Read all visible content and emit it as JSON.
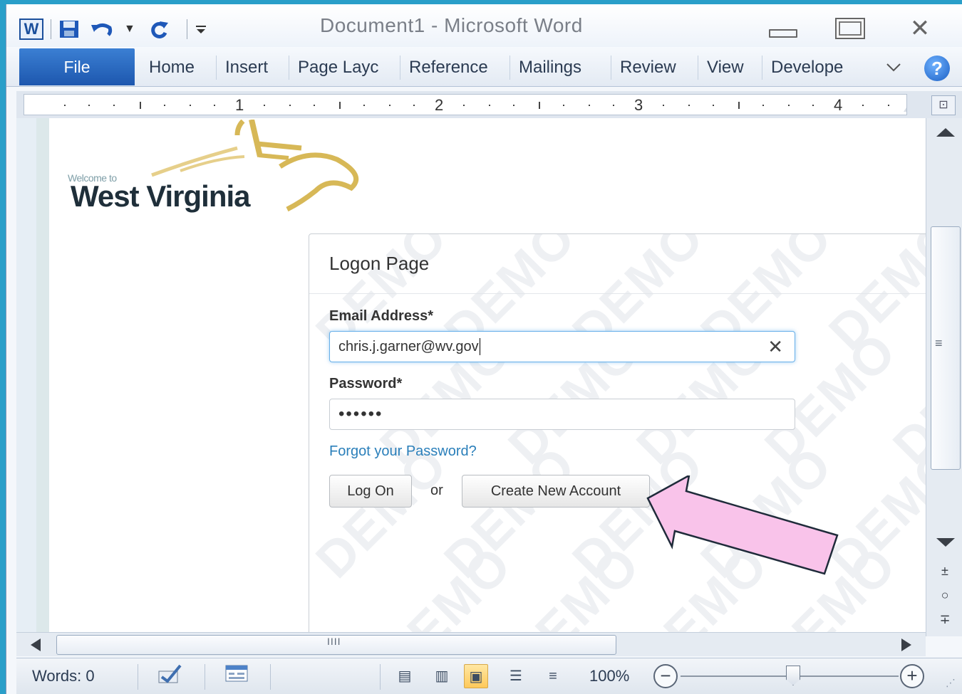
{
  "window": {
    "title": "Document1  -  Microsoft Word",
    "close_glyph": "✕"
  },
  "qat": {
    "app_icon": "W",
    "save_icon": "floppy-disk-icon",
    "undo_icon": "undo-icon",
    "redo_icon": "redo-icon",
    "customize_icon": "customize-qat-icon"
  },
  "ribbon": {
    "file_label": "File",
    "tabs": [
      "Home",
      "Insert",
      "Page Layc",
      "Reference",
      "Mailings",
      "Review",
      "View",
      "Develope"
    ],
    "collapse_icon": "chevron-down-icon",
    "help_label": "?"
  },
  "ruler": {
    "numbers": [
      "1",
      "2",
      "3",
      "4"
    ]
  },
  "document": {
    "logo": {
      "welcome": "Welcome to",
      "name": "West Virginia"
    },
    "logon": {
      "title": "Logon Page",
      "email_label": "Email Address*",
      "email_value": "chris.j.garner@wv.gov",
      "clear_glyph": "✕",
      "password_label": "Password*",
      "password_mask": "••••••",
      "forgot_link": "Forgot your Password?",
      "logon_button": "Log On",
      "or_text": "or",
      "create_button": "Create New Account",
      "watermark": "DEMO"
    },
    "annotation": {
      "arrow_color": "#f9c3ea"
    }
  },
  "scrollbars": {
    "vertical_grip": "≡",
    "prev_page_glyph": "±",
    "browse_glyph": "○",
    "next_page_glyph": "∓",
    "horizontal_grip": "IIII"
  },
  "statusbar": {
    "words_label": "Words: 0",
    "zoom_percent": "100%",
    "zoom_minus": "−",
    "zoom_plus": "+",
    "zoom_level": 1.0
  },
  "colors": {
    "file_tab": "#2a66c0",
    "link": "#2a7fba",
    "focus_ring": "#66afe9"
  }
}
